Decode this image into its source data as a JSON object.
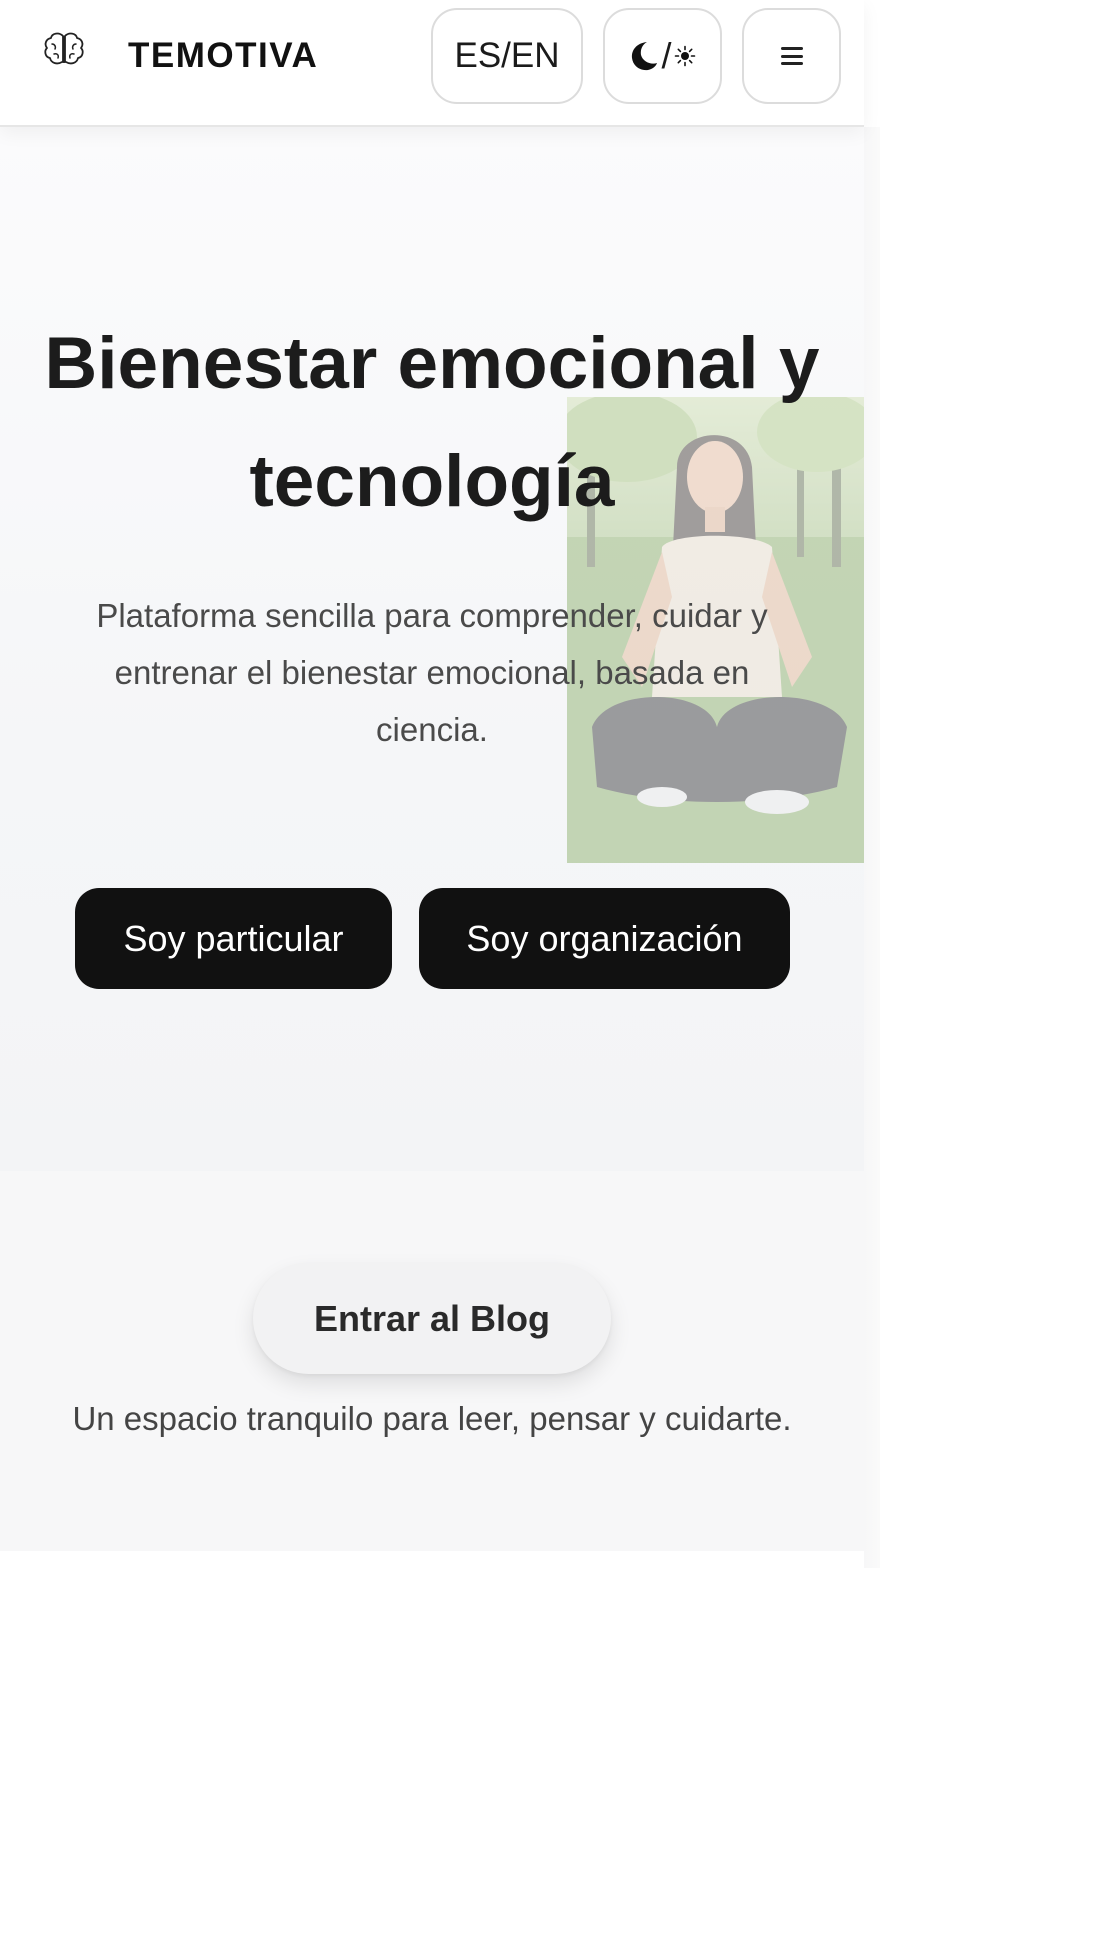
{
  "header": {
    "brand": "TEMOTIVA",
    "logo_icon": "brain-icon",
    "lang_label": "ES/EN",
    "theme_slash": "/",
    "theme_icons": [
      "moon-icon",
      "sun-icon"
    ],
    "menu_icon": "hamburger-icon"
  },
  "hero": {
    "title_lines": [
      "Bienestar emocional y",
      "tecnología"
    ],
    "subtitle_lines": [
      "Plataforma sencilla para comprender, cuidar y",
      "entrenar el bienestar emocional, basada en",
      "ciencia."
    ],
    "cta_particular": "Soy particular",
    "cta_organization": "Soy organización"
  },
  "blog": {
    "button_label": "Entrar al Blog",
    "tagline": "Un espacio tranquilo para leer, pensar y cuidarte."
  },
  "colors": {
    "primary_button": "#111111",
    "text": "#1c1c1c",
    "muted_text": "#4a4a4a",
    "background": "#f5f6f8"
  }
}
